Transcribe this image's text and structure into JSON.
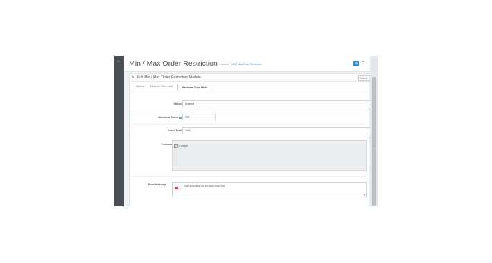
{
  "sidebar": {
    "home_icon": "house-icon"
  },
  "header": {
    "title": "Min / Max Order Restriction",
    "breadcrumb": [
      "Home",
      "Modules",
      "Min / Max Order Restriction"
    ],
    "action_button": "⊞",
    "help_icon": "chevron-up-icon"
  },
  "panel": {
    "title": "Edit Min / Max Order Restriction Module",
    "language_selector": "Default"
  },
  "tabs": [
    {
      "label": "General"
    },
    {
      "label": "Minimum Price Limit"
    },
    {
      "label": "Maximum Price Limit"
    }
  ],
  "form": {
    "status": {
      "label": "Status",
      "value": "Enabled"
    },
    "maximum_value": {
      "label": "Maximum Value",
      "value": "255"
    },
    "order_total": {
      "label": "Order Total",
      "value": "Total"
    },
    "customer_group": {
      "label": "Customer Group",
      "option": "Default",
      "checked": true
    },
    "error_message": {
      "label": "Error Message",
      "value": "Total should be not be more than 255"
    }
  },
  "colors": {
    "accent": "#2b8ad0",
    "sidebar": "#4a4f55",
    "background": "#eef1f3"
  }
}
